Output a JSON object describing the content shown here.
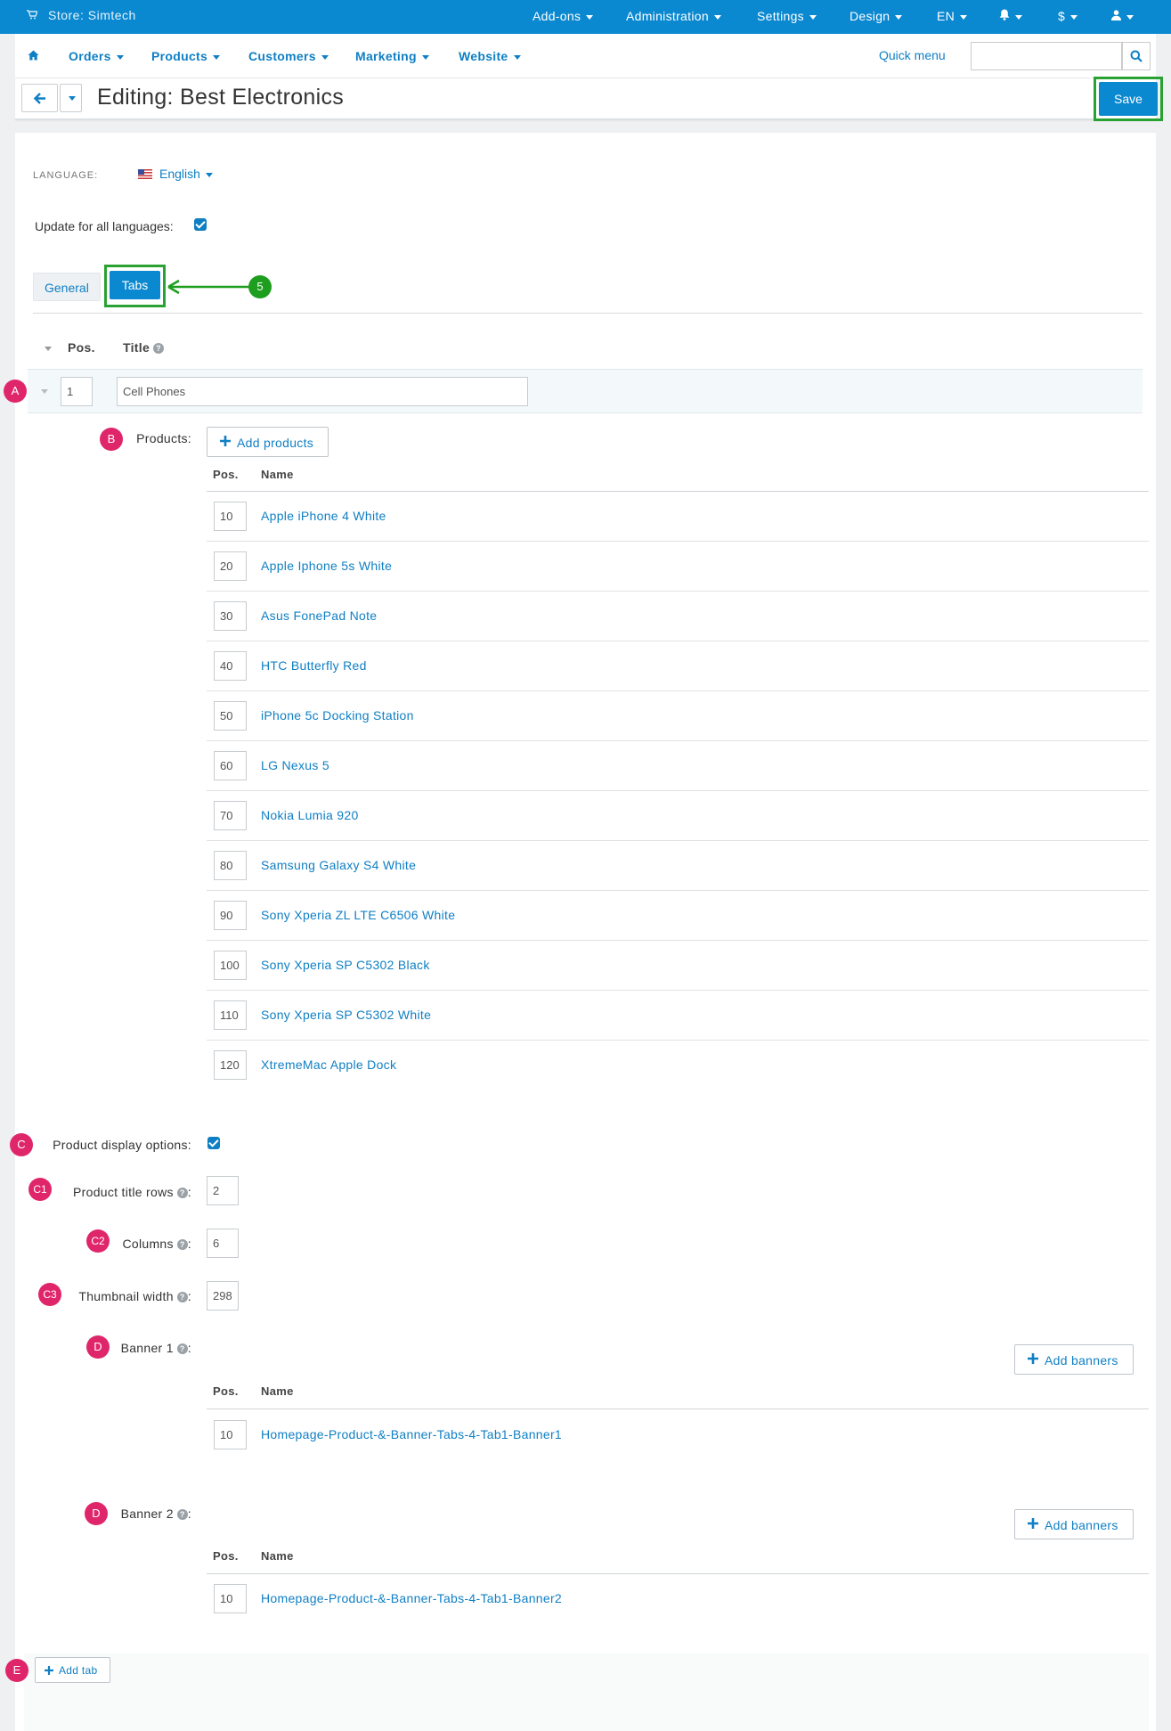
{
  "topbar": {
    "store_label": "Store: Simtech",
    "menus": [
      "Add-ons",
      "Administration",
      "Settings",
      "Design",
      "EN",
      "$"
    ]
  },
  "nav": {
    "items": [
      "Orders",
      "Products",
      "Customers",
      "Marketing",
      "Website"
    ],
    "quick_menu": "Quick menu",
    "search_value": ""
  },
  "header": {
    "title": "Editing: Best Electronics",
    "save_label": "Save"
  },
  "language": {
    "label": "LANGUAGE:",
    "value": "English"
  },
  "update_all": {
    "label": "Update for all languages:",
    "checked": true
  },
  "tabs": {
    "general": "General",
    "tabs": "Tabs",
    "callout": "5"
  },
  "tab_table": {
    "col_pos": "Pos.",
    "col_title": "Title",
    "row_pos": "1",
    "row_title": "Cell Phones"
  },
  "products": {
    "label": "Products:",
    "add_label": "Add products",
    "col_pos": "Pos.",
    "col_name": "Name",
    "items": [
      {
        "pos": "10",
        "name": "Apple iPhone 4 White"
      },
      {
        "pos": "20",
        "name": "Apple Iphone 5s White"
      },
      {
        "pos": "30",
        "name": "Asus FonePad Note"
      },
      {
        "pos": "40",
        "name": "HTC Butterfly Red"
      },
      {
        "pos": "50",
        "name": "iPhone 5c Docking Station"
      },
      {
        "pos": "60",
        "name": "LG Nexus 5"
      },
      {
        "pos": "70",
        "name": "Nokia Lumia 920"
      },
      {
        "pos": "80",
        "name": "Samsung Galaxy S4 White"
      },
      {
        "pos": "90",
        "name": "Sony Xperia ZL LTE C6506 White"
      },
      {
        "pos": "100",
        "name": "Sony Xperia SP C5302 Black"
      },
      {
        "pos": "110",
        "name": "Sony Xperia SP C5302 White"
      },
      {
        "pos": "120",
        "name": "XtremeMac Apple Dock"
      }
    ]
  },
  "display_options": {
    "label": "Product display options:",
    "checked": true,
    "title_rows_label": "Product title rows",
    "title_rows": "2",
    "columns_label": "Columns",
    "columns": "6",
    "thumb_label": "Thumbnail width",
    "thumb": "298"
  },
  "banner1": {
    "label": "Banner 1",
    "add_label": "Add banners",
    "col_pos": "Pos.",
    "col_name": "Name",
    "pos": "10",
    "name": "Homepage-Product-&-Banner-Tabs-4-Tab1-Banner1"
  },
  "banner2": {
    "label": "Banner 2",
    "add_label": "Add banners",
    "col_pos": "Pos.",
    "col_name": "Name",
    "pos": "10",
    "name": "Homepage-Product-&-Banner-Tabs-4-Tab1-Banner2"
  },
  "add_tab": "Add tab",
  "markers": {
    "a": "A",
    "b": "B",
    "c": "C",
    "c1": "C1",
    "c2": "C2",
    "c3": "C3",
    "d1": "D",
    "d2": "D",
    "e": "E"
  },
  "colors": {
    "topbar": "#0a88d0",
    "link": "#0f7fc4",
    "marker": "#e0266a",
    "highlight_frame": "#2aa233"
  }
}
